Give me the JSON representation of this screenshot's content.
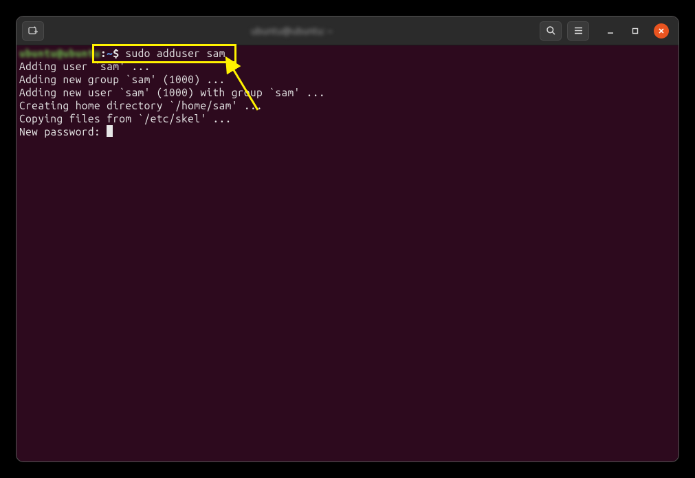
{
  "titlebar": {
    "title": "ubuntu@ubuntu: ~"
  },
  "terminal": {
    "prompt_user": "ubuntu@ubuntu",
    "prompt_sep": ":",
    "prompt_path": "~",
    "prompt_dollar": "$ ",
    "command": "sudo adduser sam",
    "lines": [
      "Adding user `sam' ...",
      "Adding new group `sam' (1000) ...",
      "Adding new user `sam' (1000) with group `sam' ...",
      "Creating home directory `/home/sam' ...",
      "Copying files from `/etc/skel' ...",
      "New password: "
    ]
  }
}
